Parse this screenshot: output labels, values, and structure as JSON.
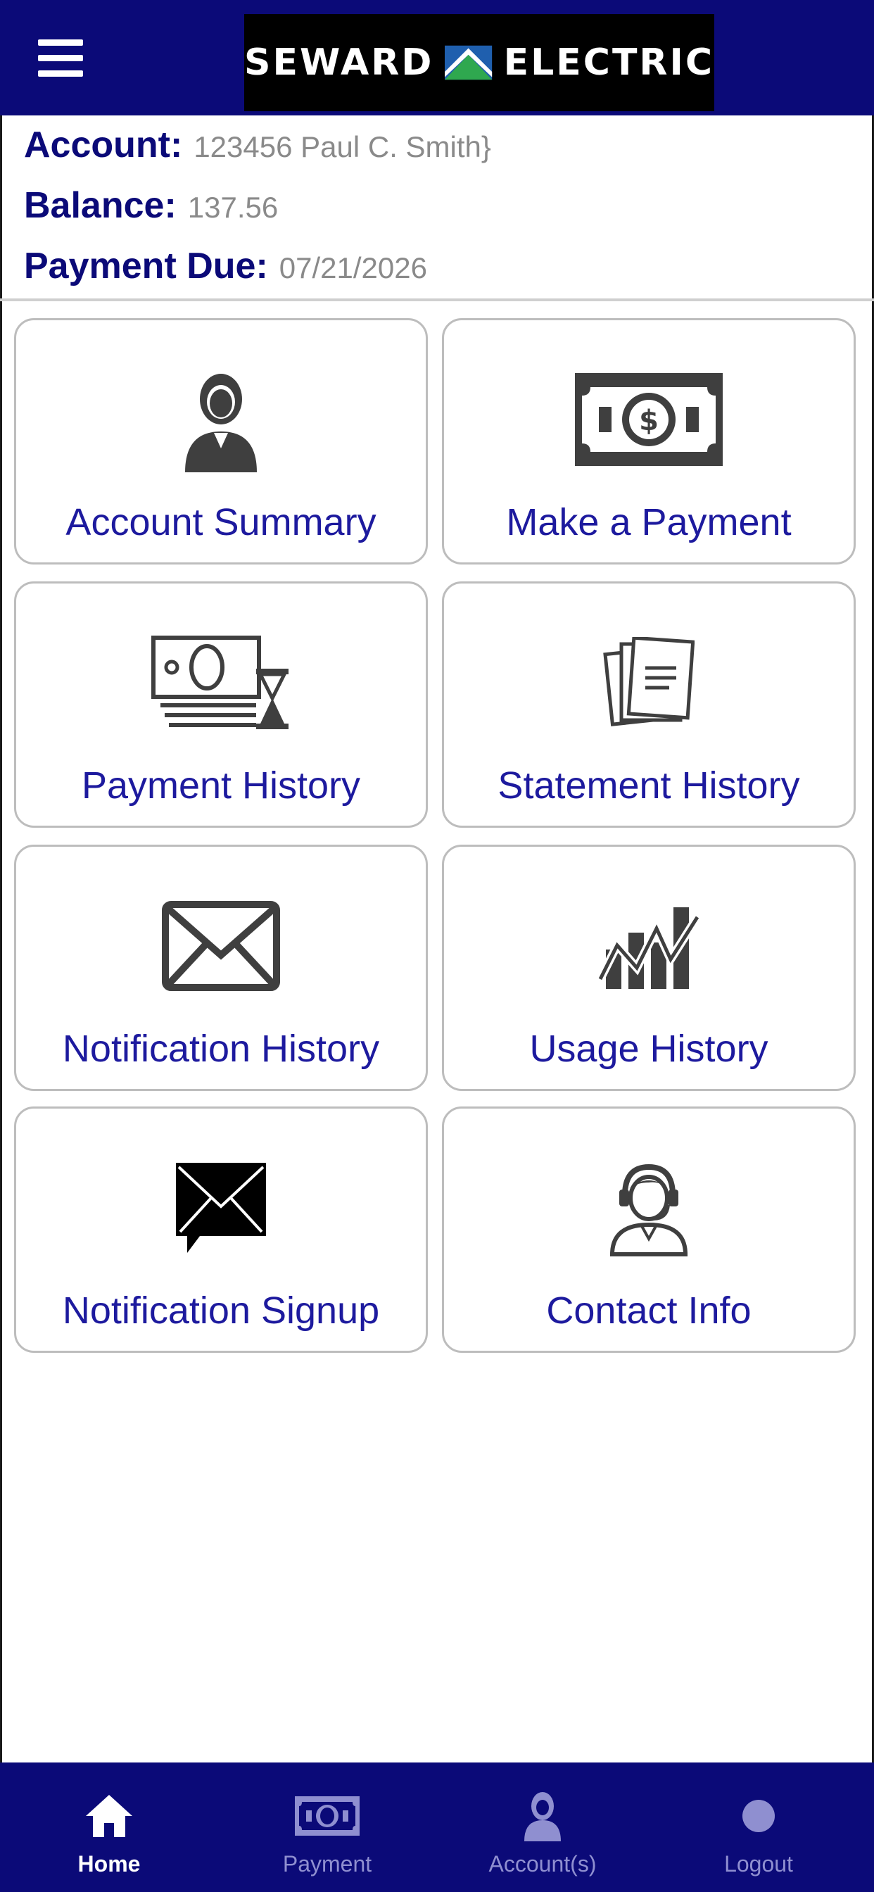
{
  "header": {
    "menu_icon": "hamburger-icon",
    "logo_left": "SEWARD",
    "logo_right": "ELECTRIC",
    "logo_colors": {
      "green": "#2fa84f",
      "blue": "#1f5fae",
      "white": "#ffffff"
    }
  },
  "account": {
    "account_label": "Account:",
    "account_value": "123456  Paul C. Smith}",
    "balance_label": "Balance:",
    "balance_value": "137.56",
    "due_label": "Payment Due:",
    "due_value": "07/21/2026"
  },
  "tiles": [
    {
      "label": "Account Summary",
      "icon": "person-icon"
    },
    {
      "label": "Make a Payment",
      "icon": "banknote-icon"
    },
    {
      "label": "Payment History",
      "icon": "money-hourglass-icon"
    },
    {
      "label": "Statement History",
      "icon": "documents-icon"
    },
    {
      "label": "Notification History",
      "icon": "envelope-icon"
    },
    {
      "label": "Usage History",
      "icon": "usage-chart-icon"
    },
    {
      "label": "Notification Signup",
      "icon": "envelope-chat-icon"
    },
    {
      "label": "Contact Info",
      "icon": "headset-person-icon"
    }
  ],
  "bottom_nav": [
    {
      "label": "Home",
      "icon": "home-icon",
      "active": true
    },
    {
      "label": "Payment",
      "icon": "banknote-icon",
      "active": false
    },
    {
      "label": "Account(s)",
      "icon": "person-icon",
      "active": false
    },
    {
      "label": "Logout",
      "icon": "dot-icon",
      "active": false
    }
  ],
  "colors": {
    "brand_navy": "#0b0a78",
    "tile_label": "#1d1a9e",
    "icon_gray": "#3f3f3f",
    "nav_inactive": "#8f8fd0"
  }
}
